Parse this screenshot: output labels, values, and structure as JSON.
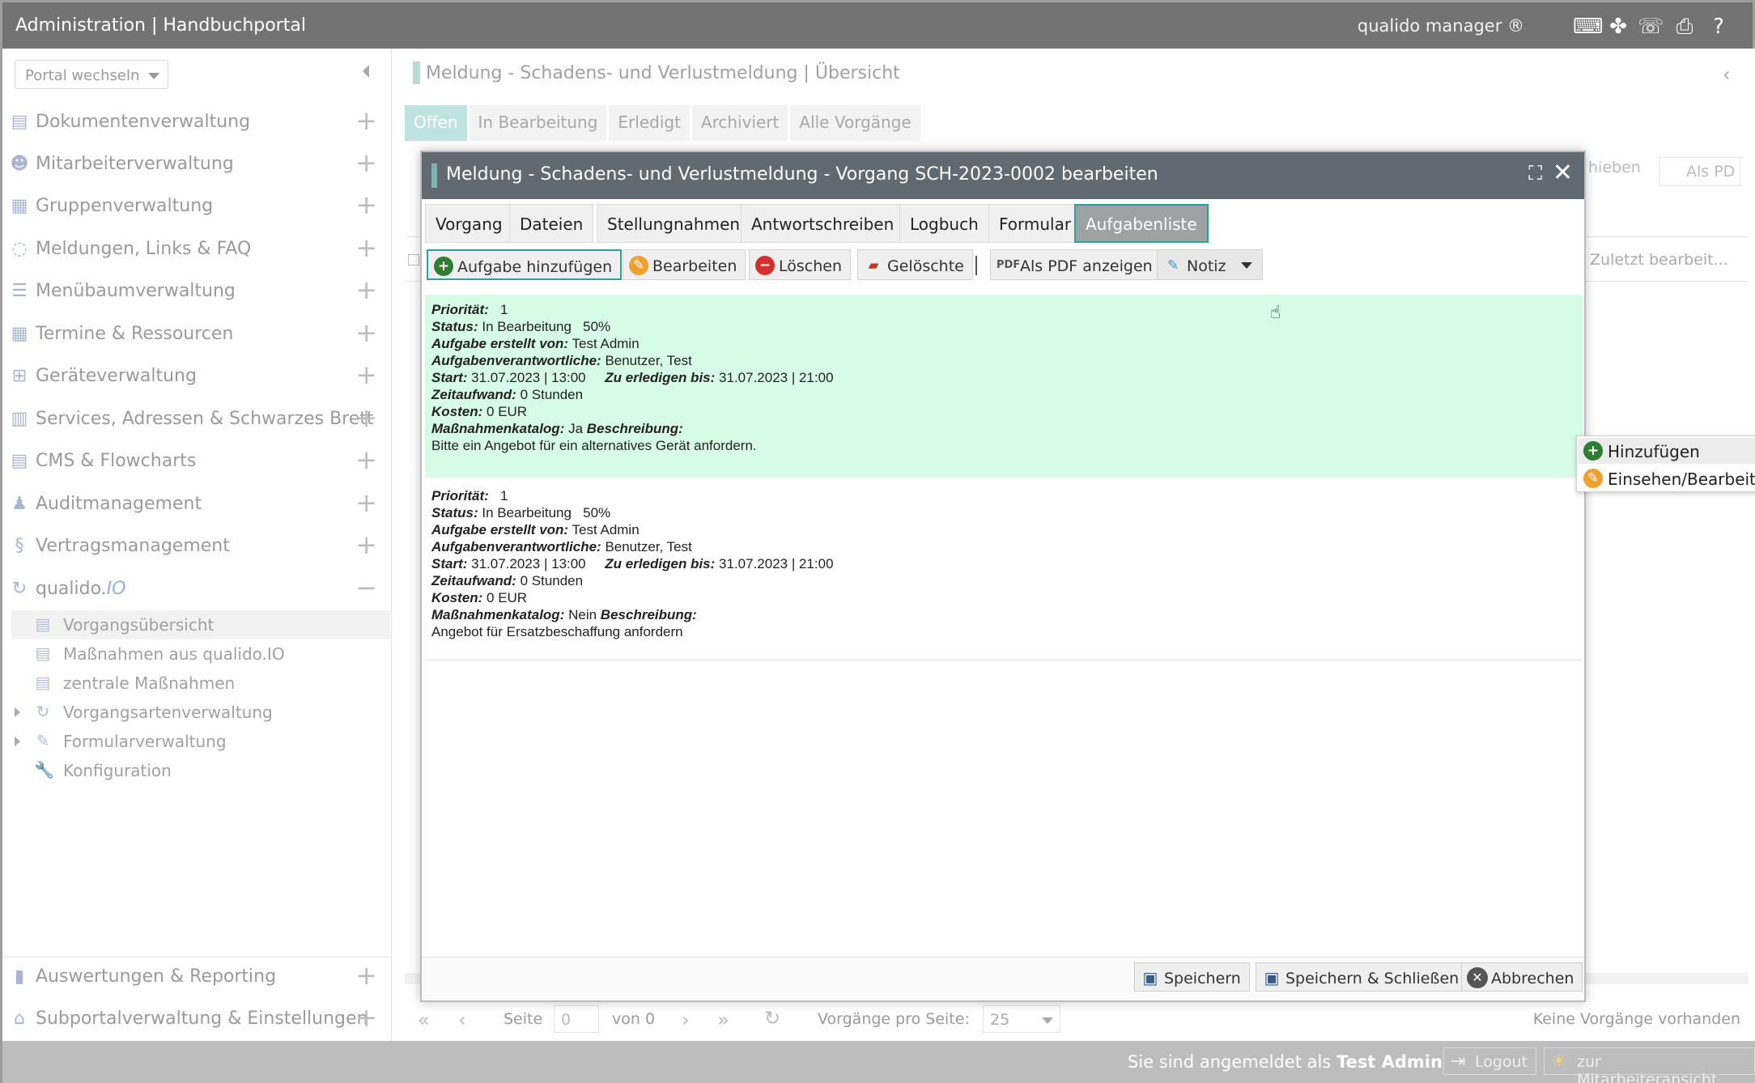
{
  "topbar": {
    "title": "Administration | Handbuchportal",
    "brand": "qualido manager ®",
    "icons": [
      "keyboard-icon",
      "sitemap-icon",
      "fax-icon",
      "printer-icon",
      "help-icon"
    ]
  },
  "sidebar": {
    "portal_select": "Portal wechseln",
    "items": [
      {
        "label": "Dokumentenverwaltung",
        "icon": "documents-icon",
        "glyph": "▤"
      },
      {
        "label": "Mitarbeiterverwaltung",
        "icon": "users-icon",
        "glyph": "👥"
      },
      {
        "label": "Gruppenverwaltung",
        "icon": "groups-icon",
        "glyph": "▦"
      },
      {
        "label": "Meldungen, Links & FAQ",
        "icon": "chat-icon",
        "glyph": "💬"
      },
      {
        "label": "Menübaumverwaltung",
        "icon": "list-icon",
        "glyph": "☰"
      },
      {
        "label": "Termine & Ressourcen",
        "icon": "calendar-icon",
        "glyph": "▦"
      },
      {
        "label": "Geräteverwaltung",
        "icon": "device-icon",
        "glyph": "⊞"
      },
      {
        "label": "Services, Adressen & Schwarzes Brett",
        "icon": "book-icon",
        "glyph": "▥"
      },
      {
        "label": "CMS & Flowcharts",
        "icon": "cms-icon",
        "glyph": "▤"
      },
      {
        "label": "Auditmanagement",
        "icon": "auditor-icon",
        "glyph": "👤"
      },
      {
        "label": "Vertragsmanagement",
        "icon": "paragraph-icon",
        "glyph": "§"
      }
    ],
    "qualido": {
      "label_main": "qualido.",
      "label_io": "IO"
    },
    "subitems": [
      {
        "label": "Vorgangsübersicht",
        "icon": "document-icon"
      },
      {
        "label": "Maßnahmen aus qualido.IO",
        "icon": "document-icon"
      },
      {
        "label": "zentrale Maßnahmen",
        "icon": "document-icon"
      },
      {
        "label": "Vorgangsartenverwaltung",
        "icon": "cycle-icon"
      },
      {
        "label": "Formularverwaltung",
        "icon": "form-edit-icon"
      },
      {
        "label": "Konfiguration",
        "icon": "wrench-icon"
      }
    ],
    "bottom_items": [
      {
        "label": "Auswertungen & Reporting",
        "icon": "chart-icon"
      },
      {
        "label": "Subportalverwaltung & Einstellungen",
        "icon": "home-icon"
      }
    ]
  },
  "main": {
    "title": "Meldung - Schadens- und Verlustmeldung | Übersicht",
    "tabs": [
      "Offen",
      "In Bearbeitung",
      "Erledigt",
      "Archiviert",
      "Alle Vorgänge"
    ],
    "bg_right_1": "hieben",
    "bg_right_2": "Als PD",
    "bg_col": "Zuletzt bearbeit..."
  },
  "dialog": {
    "title": "Meldung - Schadens- und Verlustmeldung - Vorgang SCH-2023-0002 bearbeiten",
    "tabs": [
      "Vorgang",
      "Dateien",
      "Stellungnahmen",
      "Antwortschreiben",
      "Logbuch",
      "Formular",
      "Aufgabenliste"
    ],
    "toolbar": {
      "add": "Aufgabe hinzufügen",
      "edit": "Bearbeiten",
      "delete": "Löschen",
      "deleted": "Gelöschte",
      "pdf": "Als PDF anzeigen",
      "note": "Notiz"
    },
    "dropdown": [
      "Hinzufügen",
      "Einsehen/Bearbeiten"
    ],
    "labels": {
      "priority": "Priorität:",
      "status": "Status:",
      "created_by": "Aufgabe erstellt von:",
      "responsible": "Aufgabenverantwortliche:",
      "start": "Start:",
      "due": "Zu erledigen bis:",
      "effort": "Zeitaufwand:",
      "cost": "Kosten:",
      "catalog": "Maßnahmenkatalog:",
      "description": "Beschreibung:"
    },
    "tasks": [
      {
        "priority": "1",
        "status": "In Bearbeitung   50%",
        "created_by": "Test Admin",
        "responsible": "Benutzer, Test",
        "start": "31.07.2023 | 13:00",
        "due": "31.07.2023 | 21:00",
        "effort": "0 Stunden",
        "cost": "0 EUR",
        "catalog": "Ja",
        "description": "Bitte ein Angebot für ein alternatives Gerät anfordern."
      },
      {
        "priority": "1",
        "status": "In Bearbeitung   50%",
        "created_by": "Test Admin",
        "responsible": "Benutzer, Test",
        "start": "31.07.2023 | 13:00",
        "due": "31.07.2023 | 21:00",
        "effort": "0 Stunden",
        "cost": "0 EUR",
        "catalog": "Nein",
        "description": "Angebot für Ersatzbeschaffung anfordern"
      }
    ],
    "footer": {
      "save": "Speichern",
      "save_close": "Speichern & Schließen",
      "cancel": "Abbrechen"
    }
  },
  "pager": {
    "page_label": "Seite",
    "page_value": "0",
    "of": "von 0",
    "per_page_label": "Vorgänge pro Seite:",
    "per_page": "25",
    "empty": "Keine Vorgänge vorhanden"
  },
  "bottombar": {
    "logged_prefix": "Sie sind angemeldet als",
    "user": "Test Admin",
    "logout": "Logout",
    "employee_view": "zur Mitarbeiteransicht"
  },
  "colors": {
    "accent_teal": "#26a69a",
    "row_highlight": "#d7fce6",
    "dialog_header": "#616a71",
    "add_green": "#2e7d32",
    "edit_orange": "#f0a030",
    "delete_red": "#d32f2f"
  }
}
